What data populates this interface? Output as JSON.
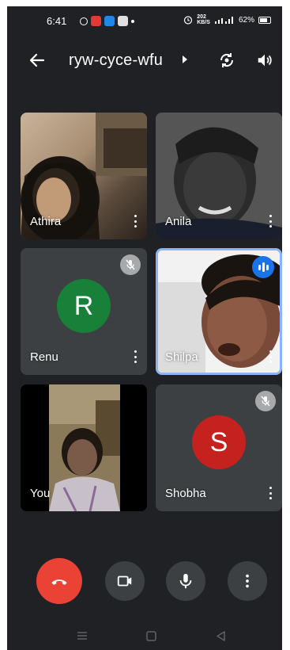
{
  "status_bar": {
    "time": "6:41",
    "network_speed": "202",
    "network_speed_unit": "KB/S",
    "battery": "62%"
  },
  "header": {
    "meeting_code": "ryw-cyce-wfu"
  },
  "participants": [
    {
      "name": "Athira",
      "type": "video"
    },
    {
      "name": "Anila",
      "type": "video"
    },
    {
      "name": "Renu",
      "type": "avatar",
      "initial": "R",
      "avatar_color": "#188038",
      "muted": true
    },
    {
      "name": "Shilpa",
      "type": "video",
      "speaking": true
    },
    {
      "name": "You",
      "type": "video"
    },
    {
      "name": "Shobha",
      "type": "avatar",
      "initial": "S",
      "avatar_color": "#c5221f",
      "muted": true
    }
  ],
  "controls": [
    "end-call",
    "camera",
    "microphone",
    "more-options"
  ],
  "colors": {
    "background": "#202124",
    "tile": "#3c4043",
    "hangup": "#ea4335",
    "speaking_accent": "#1a73e8"
  }
}
